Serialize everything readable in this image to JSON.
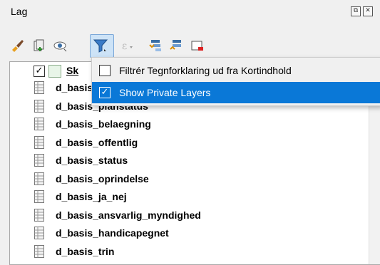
{
  "panel": {
    "title": "Lag",
    "float_glyph": "⧉",
    "close_glyph": "✕"
  },
  "toolbar": {
    "icons": [
      "style-brush-icon",
      "add-group-icon",
      "visibility-eye-icon",
      "filter-icon",
      "expression-filter-icon",
      "expand-all-icon",
      "collapse-all-icon",
      "remove-layer-icon"
    ]
  },
  "tree": {
    "group": {
      "label": "Sk",
      "checked": "✓"
    },
    "layers": [
      "d_basis",
      "d_basis_planstatus",
      "d_basis_belaegning",
      "d_basis_offentlig",
      "d_basis_status",
      "d_basis_oprindelse",
      "d_basis_ja_nej",
      "d_basis_ansvarlig_myndighed",
      "d_basis_handicapegnet",
      "d_basis_trin"
    ]
  },
  "menu": {
    "items": [
      {
        "label": "Filtrér Tegnforklaring ud fra Kortindhold",
        "check": ""
      },
      {
        "label": "Show Private Layers",
        "check": "✓"
      }
    ]
  },
  "colors": {
    "selection": "#0a78d7",
    "active_tool_bg": "#cde3f7"
  }
}
